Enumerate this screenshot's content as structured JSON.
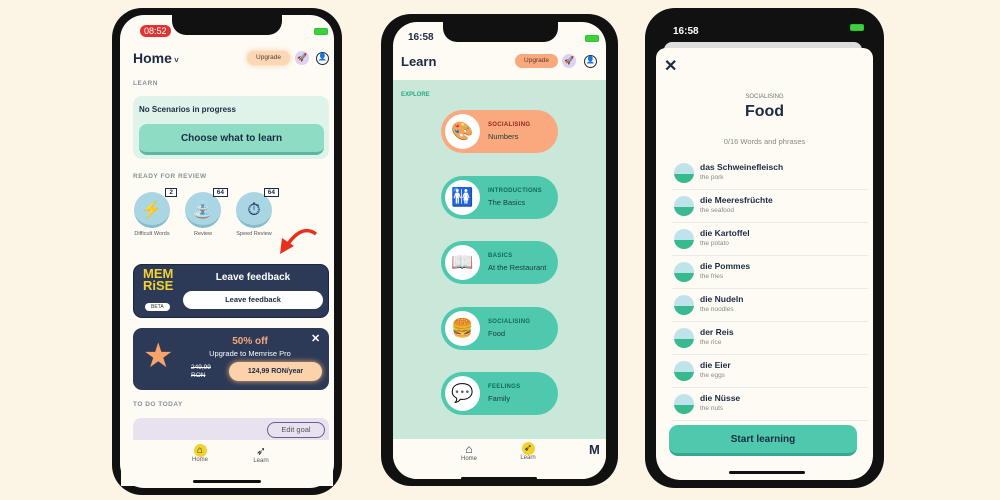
{
  "colors": {
    "background": "#fcf4e4",
    "teal": "#4fc9ae",
    "orange": "#f9a97d",
    "navy": "#2c3a57"
  },
  "home": {
    "status_time": "08:52",
    "title": "Home",
    "upgrade": "Upgrade",
    "learn_section": "LEARN",
    "no_scenarios": "No Scenarios in progress",
    "choose_button": "Choose what to learn",
    "review_section": "READY FOR REVIEW",
    "review_items": [
      {
        "label": "Difficult Words",
        "count": "2",
        "icon": "lightning-icon"
      },
      {
        "label": "Review",
        "count": "64",
        "icon": "watering-can-icon"
      },
      {
        "label": "Speed Review",
        "count": "64",
        "icon": "stopwatch-icon"
      }
    ],
    "feedback": {
      "logo": "MEMRISE",
      "beta": "BETA",
      "title": "Leave feedback",
      "button": "Leave feedback"
    },
    "promo": {
      "discount": "50% off",
      "subtitle": "Upgrade to Memrise Pro",
      "old_price": "249,99 RON",
      "price": "124,99 RON/year"
    },
    "todo_section": "TO DO TODAY",
    "edit_goal": "Edit goal",
    "nav": {
      "home": "Home",
      "learn": "Learn"
    }
  },
  "learn": {
    "status_time": "16:58",
    "title": "Learn",
    "upgrade": "Upgrade",
    "explore": "EXPLORE",
    "cards": [
      {
        "category": "SOCIALISING",
        "name": "Numbers",
        "icon": "palette-icon",
        "active": true
      },
      {
        "category": "INTRODUCTIONS",
        "name": "The Basics",
        "icon": "people-icon"
      },
      {
        "category": "BASICS",
        "name": "At the Restaurant",
        "icon": "book-icon"
      },
      {
        "category": "SOCIALISING",
        "name": "Food",
        "icon": "burger-drink-icon"
      },
      {
        "category": "FEELINGS",
        "name": "Family",
        "icon": "chat-bubble-icon"
      }
    ],
    "nav": {
      "home": "Home",
      "learn": "Learn",
      "more": "M"
    }
  },
  "food": {
    "status_time": "16:58",
    "category": "SOCIALISING",
    "title": "Food",
    "progress": "0/16 Words and phrases",
    "words": [
      {
        "word": "das Schweinefleisch",
        "translation": "the pork"
      },
      {
        "word": "die Meeresfrüchte",
        "translation": "the seafood"
      },
      {
        "word": "die Kartoffel",
        "translation": "the potato"
      },
      {
        "word": "die Pommes",
        "translation": "the fries"
      },
      {
        "word": "die Nudeln",
        "translation": "the noodles"
      },
      {
        "word": "der Reis",
        "translation": "the rice"
      },
      {
        "word": "die Eier",
        "translation": "the eggs"
      },
      {
        "word": "die Nüsse",
        "translation": "the nuts"
      }
    ],
    "start_button": "Start learning"
  }
}
